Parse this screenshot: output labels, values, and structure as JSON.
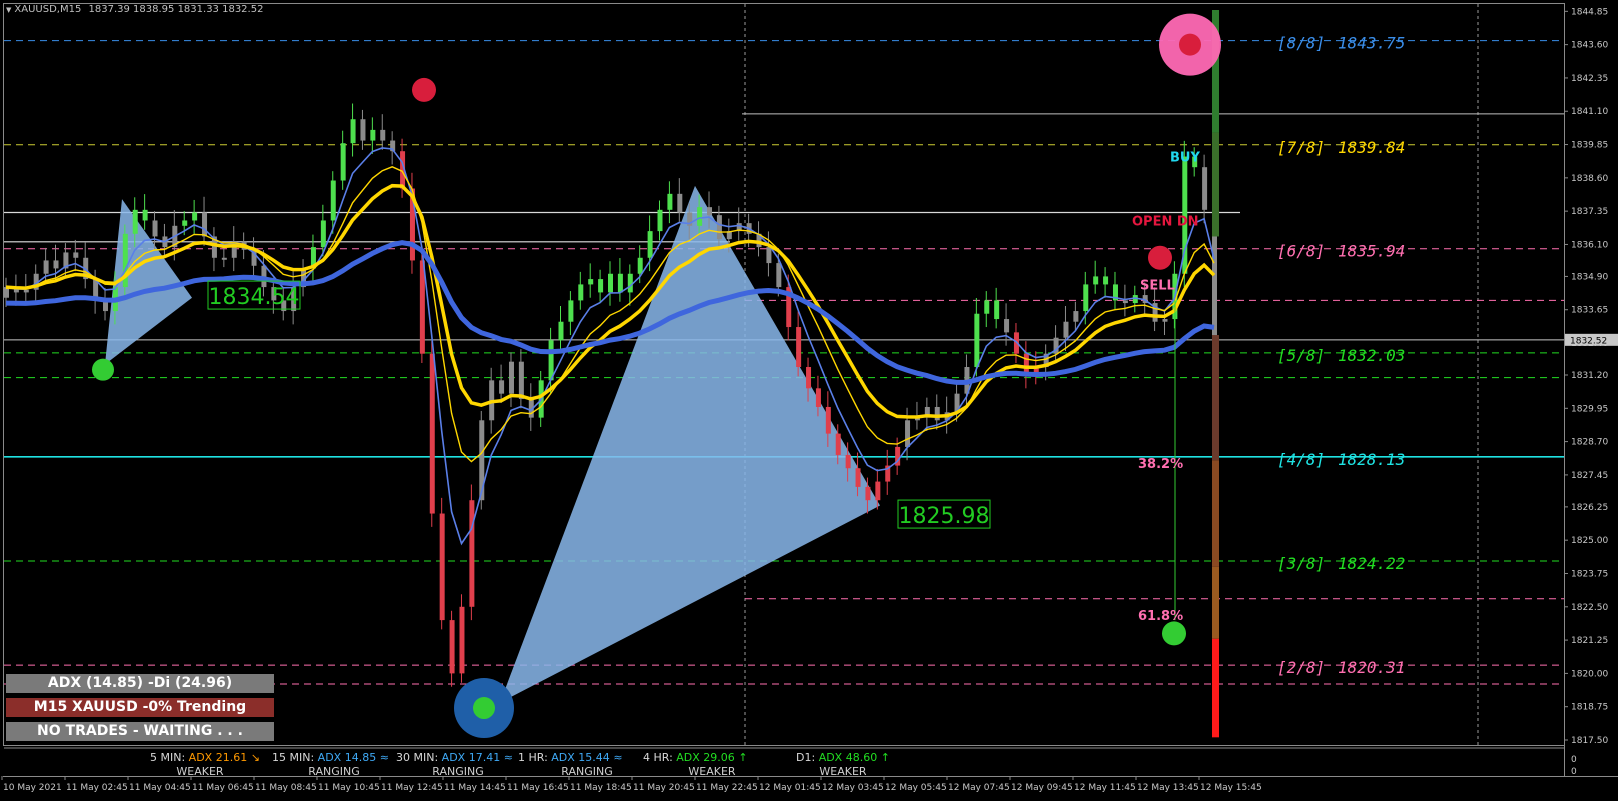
{
  "header": {
    "symbol": "XAUUSD,M15",
    "ohlc": "1837.39 1838.95 1831.33 1832.52"
  },
  "colors": {
    "background": "#000000",
    "bull": "#4ee04e",
    "bear": "#e03f4c",
    "neutral": "#8c8c8c",
    "ma_fast": "#5a7fe8",
    "ma_yellow": "#ffd700",
    "ma_slow": "#3f66dd",
    "zigzag": "#8ab9ec"
  },
  "murrey_levels": [
    {
      "label": "[8/8]",
      "value": "1843.75",
      "price": 1843.75,
      "color": "#3a8de8",
      "style": "dash"
    },
    {
      "label": "[7/8]",
      "value": "1839.84",
      "price": 1839.84,
      "color": "#ffd700",
      "style": "dash",
      "lineColor": "#cccc33"
    },
    {
      "label": "[6/8]",
      "value": "1835.94",
      "price": 1835.94,
      "color": "#ff6fb0",
      "style": "dash"
    },
    {
      "label": "[5/8]",
      "value": "1832.03",
      "price": 1832.03,
      "color": "#22dd22",
      "style": "dash"
    },
    {
      "label": "[4/8]",
      "value": "1828.13",
      "price": 1828.13,
      "color": "#1fe3e3",
      "style": "solid"
    },
    {
      "label": "[3/8]",
      "value": "1824.22",
      "price": 1824.22,
      "color": "#22dd22",
      "style": "dash"
    },
    {
      "label": "[2/8]",
      "value": "1820.31",
      "price": 1820.31,
      "color": "#ff6fb0",
      "style": "dash"
    }
  ],
  "fib_labels": [
    {
      "text": "38.2%",
      "price": 1827.9,
      "color": "#ff6fb0"
    },
    {
      "text": "61.8%",
      "price": 1822.2,
      "color": "#ff6fb0"
    }
  ],
  "signal_labels": [
    {
      "text": "BUY",
      "price": 1839.4,
      "color": "#21d7ee"
    },
    {
      "text": "OPEN DN",
      "price": 1837.0,
      "color": "#e5173f"
    },
    {
      "text": "SELL",
      "price": 1834.6,
      "color": "#ff6fb0"
    }
  ],
  "price_boxes": [
    {
      "text": "1834.54",
      "price": 1834.2,
      "color": "#22cc22"
    },
    {
      "text": "1825.98",
      "price": 1825.98,
      "color": "#22cc22"
    }
  ],
  "current_price": "1832.52",
  "panel": {
    "adx": "ADX (14.85)  -Di (24.96)",
    "trend": "M15 XAUUSD -0% Trending",
    "status": "NO TRADES - WAITING . . ."
  },
  "timeframes": [
    {
      "name": "5 MIN:",
      "adx": "ADX 21.61",
      "arrow": "↘",
      "color": "#ff9900",
      "state": "WEAKER"
    },
    {
      "name": "15 MIN:",
      "adx": "ADX 14.85",
      "arrow": "≈",
      "color": "#3fa9f5",
      "state": "RANGING"
    },
    {
      "name": "30 MIN:",
      "adx": "ADX 17.41",
      "arrow": "≈",
      "color": "#3fa9f5",
      "state": "RANGING"
    },
    {
      "name": "1 HR:",
      "adx": "ADX 15.44",
      "arrow": "≈",
      "color": "#3fa9f5",
      "state": "RANGING"
    },
    {
      "name": "4 HR:",
      "adx": "ADX 29.06",
      "arrow": "↑",
      "color": "#22dd22",
      "state": "WEAKER"
    },
    {
      "name": "D1:",
      "adx": "ADX 48.60",
      "arrow": "↑",
      "color": "#22dd22",
      "state": "WEAKER"
    }
  ],
  "chart_data": {
    "type": "candlestick",
    "symbol": "XAUUSD",
    "timeframe": "M15",
    "ylim": [
      1817.5,
      1844.9
    ],
    "y_ticks": [
      1844.85,
      1843.6,
      1842.35,
      1841.1,
      1839.85,
      1838.6,
      1837.35,
      1836.1,
      1834.9,
      1833.65,
      1832.4,
      1831.2,
      1829.95,
      1828.7,
      1827.45,
      1826.25,
      1825.0,
      1823.75,
      1822.5,
      1821.25,
      1820.0,
      1818.75,
      1817.5
    ],
    "y_tick_labels": [
      "1844.85",
      "1843.60",
      "1842.35",
      "1841.10",
      "1839.85",
      "1838.60",
      "1837.35",
      "1836.10",
      "1834.90",
      "1833.65",
      "1832.40",
      "1831.20",
      "1829.95",
      "1828.70",
      "1827.45",
      "1826.25",
      "1825.00",
      "1823.75",
      "1822.50",
      "1821.25",
      "1820.00",
      "1818.75",
      "1817.50"
    ],
    "x_tick_labels": [
      "10 May 2021",
      "11 May 02:45",
      "11 May 04:45",
      "11 May 06:45",
      "11 May 08:45",
      "11 May 10:45",
      "11 May 12:45",
      "11 May 14:45",
      "11 May 16:45",
      "11 May 18:45",
      "11 May 20:45",
      "11 May 22:45",
      "12 May 01:45",
      "12 May 03:45",
      "12 May 05:45",
      "12 May 07:45",
      "12 May 09:45",
      "12 May 11:45",
      "12 May 13:45",
      "12 May 15:45"
    ],
    "keypoints": [
      [
        1834.5,
        "neutral"
      ],
      [
        1834.3,
        "neutral"
      ],
      [
        1834.4,
        "neutral"
      ],
      [
        1835.0,
        "neutral"
      ],
      [
        1835.5,
        "neutral"
      ],
      [
        1835.2,
        "neutral"
      ],
      [
        1835.8,
        "neutral"
      ],
      [
        1835.6,
        "neutral"
      ],
      [
        1834.8,
        "neutral"
      ],
      [
        1834.0,
        "neutral"
      ],
      [
        1833.6,
        "neutral"
      ],
      [
        1834.5,
        "bull"
      ],
      [
        1836.5,
        "bull"
      ],
      [
        1837.4,
        "bull"
      ],
      [
        1837.0,
        "bull"
      ],
      [
        1836.4,
        "neutral"
      ],
      [
        1836.0,
        "neutral"
      ],
      [
        1836.8,
        "neutral"
      ],
      [
        1837.0,
        "bull"
      ],
      [
        1837.3,
        "bull"
      ],
      [
        1836.4,
        "neutral"
      ],
      [
        1835.6,
        "neutral"
      ],
      [
        1835.6,
        "neutral"
      ],
      [
        1836.2,
        "neutral"
      ],
      [
        1835.9,
        "neutral"
      ],
      [
        1835.3,
        "neutral"
      ],
      [
        1834.5,
        "neutral"
      ],
      [
        1834.0,
        "neutral"
      ],
      [
        1833.6,
        "neutral"
      ],
      [
        1834.5,
        "neutral"
      ],
      [
        1835.2,
        "neutral"
      ],
      [
        1836.0,
        "bull"
      ],
      [
        1837.0,
        "bull"
      ],
      [
        1838.5,
        "bull"
      ],
      [
        1839.9,
        "bull"
      ],
      [
        1840.8,
        "bull"
      ],
      [
        1840.0,
        "neutral"
      ],
      [
        1840.4,
        "bull"
      ],
      [
        1840.0,
        "neutral"
      ],
      [
        1839.6,
        "neutral"
      ],
      [
        1838.2,
        "bear"
      ],
      [
        1835.5,
        "bear"
      ],
      [
        1832.0,
        "bear"
      ],
      [
        1826.0,
        "bear"
      ],
      [
        1822.0,
        "bear"
      ],
      [
        1820.0,
        "bear"
      ],
      [
        1822.5,
        "bear"
      ],
      [
        1826.5,
        "bear"
      ],
      [
        1829.5,
        "neutral"
      ],
      [
        1831.0,
        "neutral"
      ],
      [
        1830.5,
        "neutral"
      ],
      [
        1831.7,
        "neutral"
      ],
      [
        1830.3,
        "neutral"
      ],
      [
        1829.6,
        "neutral"
      ],
      [
        1831.0,
        "bull"
      ],
      [
        1832.5,
        "bull"
      ],
      [
        1833.2,
        "bull"
      ],
      [
        1834.0,
        "bull"
      ],
      [
        1834.6,
        "bull"
      ],
      [
        1834.8,
        "bull"
      ],
      [
        1834.3,
        "bull"
      ],
      [
        1835.0,
        "bull"
      ],
      [
        1834.3,
        "bull"
      ],
      [
        1835.0,
        "bull"
      ],
      [
        1835.6,
        "bull"
      ],
      [
        1836.6,
        "bull"
      ],
      [
        1837.4,
        "bull"
      ],
      [
        1838.0,
        "bull"
      ],
      [
        1837.3,
        "neutral"
      ],
      [
        1836.8,
        "neutral"
      ],
      [
        1837.5,
        "bull"
      ],
      [
        1837.2,
        "neutral"
      ],
      [
        1836.3,
        "neutral"
      ],
      [
        1836.6,
        "neutral"
      ],
      [
        1836.9,
        "neutral"
      ],
      [
        1836.5,
        "neutral"
      ],
      [
        1836.0,
        "neutral"
      ],
      [
        1835.4,
        "neutral"
      ],
      [
        1834.5,
        "neutral"
      ],
      [
        1833.0,
        "bear"
      ],
      [
        1831.5,
        "bear"
      ],
      [
        1830.7,
        "bear"
      ],
      [
        1830.0,
        "bear"
      ],
      [
        1829.0,
        "bear"
      ],
      [
        1828.2,
        "bear"
      ],
      [
        1827.7,
        "bear"
      ],
      [
        1827.0,
        "bear"
      ],
      [
        1826.5,
        "bear"
      ],
      [
        1827.2,
        "bear"
      ],
      [
        1827.8,
        "bear"
      ],
      [
        1828.5,
        "bear"
      ],
      [
        1829.5,
        "neutral"
      ],
      [
        1829.6,
        "neutral"
      ],
      [
        1830.0,
        "neutral"
      ],
      [
        1829.5,
        "neutral"
      ],
      [
        1829.8,
        "neutral"
      ],
      [
        1830.5,
        "neutral"
      ],
      [
        1831.5,
        "neutral"
      ],
      [
        1833.5,
        "bull"
      ],
      [
        1834.0,
        "bull"
      ],
      [
        1833.3,
        "bull"
      ],
      [
        1832.8,
        "neutral"
      ],
      [
        1832.0,
        "bear"
      ],
      [
        1831.2,
        "bear"
      ],
      [
        1831.5,
        "bear"
      ],
      [
        1832.0,
        "neutral"
      ],
      [
        1832.6,
        "neutral"
      ],
      [
        1833.2,
        "neutral"
      ],
      [
        1833.6,
        "neutral"
      ],
      [
        1834.6,
        "bull"
      ],
      [
        1834.9,
        "bull"
      ],
      [
        1834.6,
        "bull"
      ],
      [
        1834.0,
        "bull"
      ],
      [
        1833.9,
        "neutral"
      ],
      [
        1834.2,
        "bull"
      ],
      [
        1833.9,
        "neutral"
      ],
      [
        1833.2,
        "neutral"
      ],
      [
        1833.3,
        "neutral"
      ],
      [
        1835.0,
        "bull"
      ],
      [
        1839.4,
        "bull"
      ],
      [
        1839.0,
        "bull"
      ],
      [
        1837.4,
        "neutral"
      ],
      [
        1832.52,
        "neutral"
      ]
    ]
  }
}
